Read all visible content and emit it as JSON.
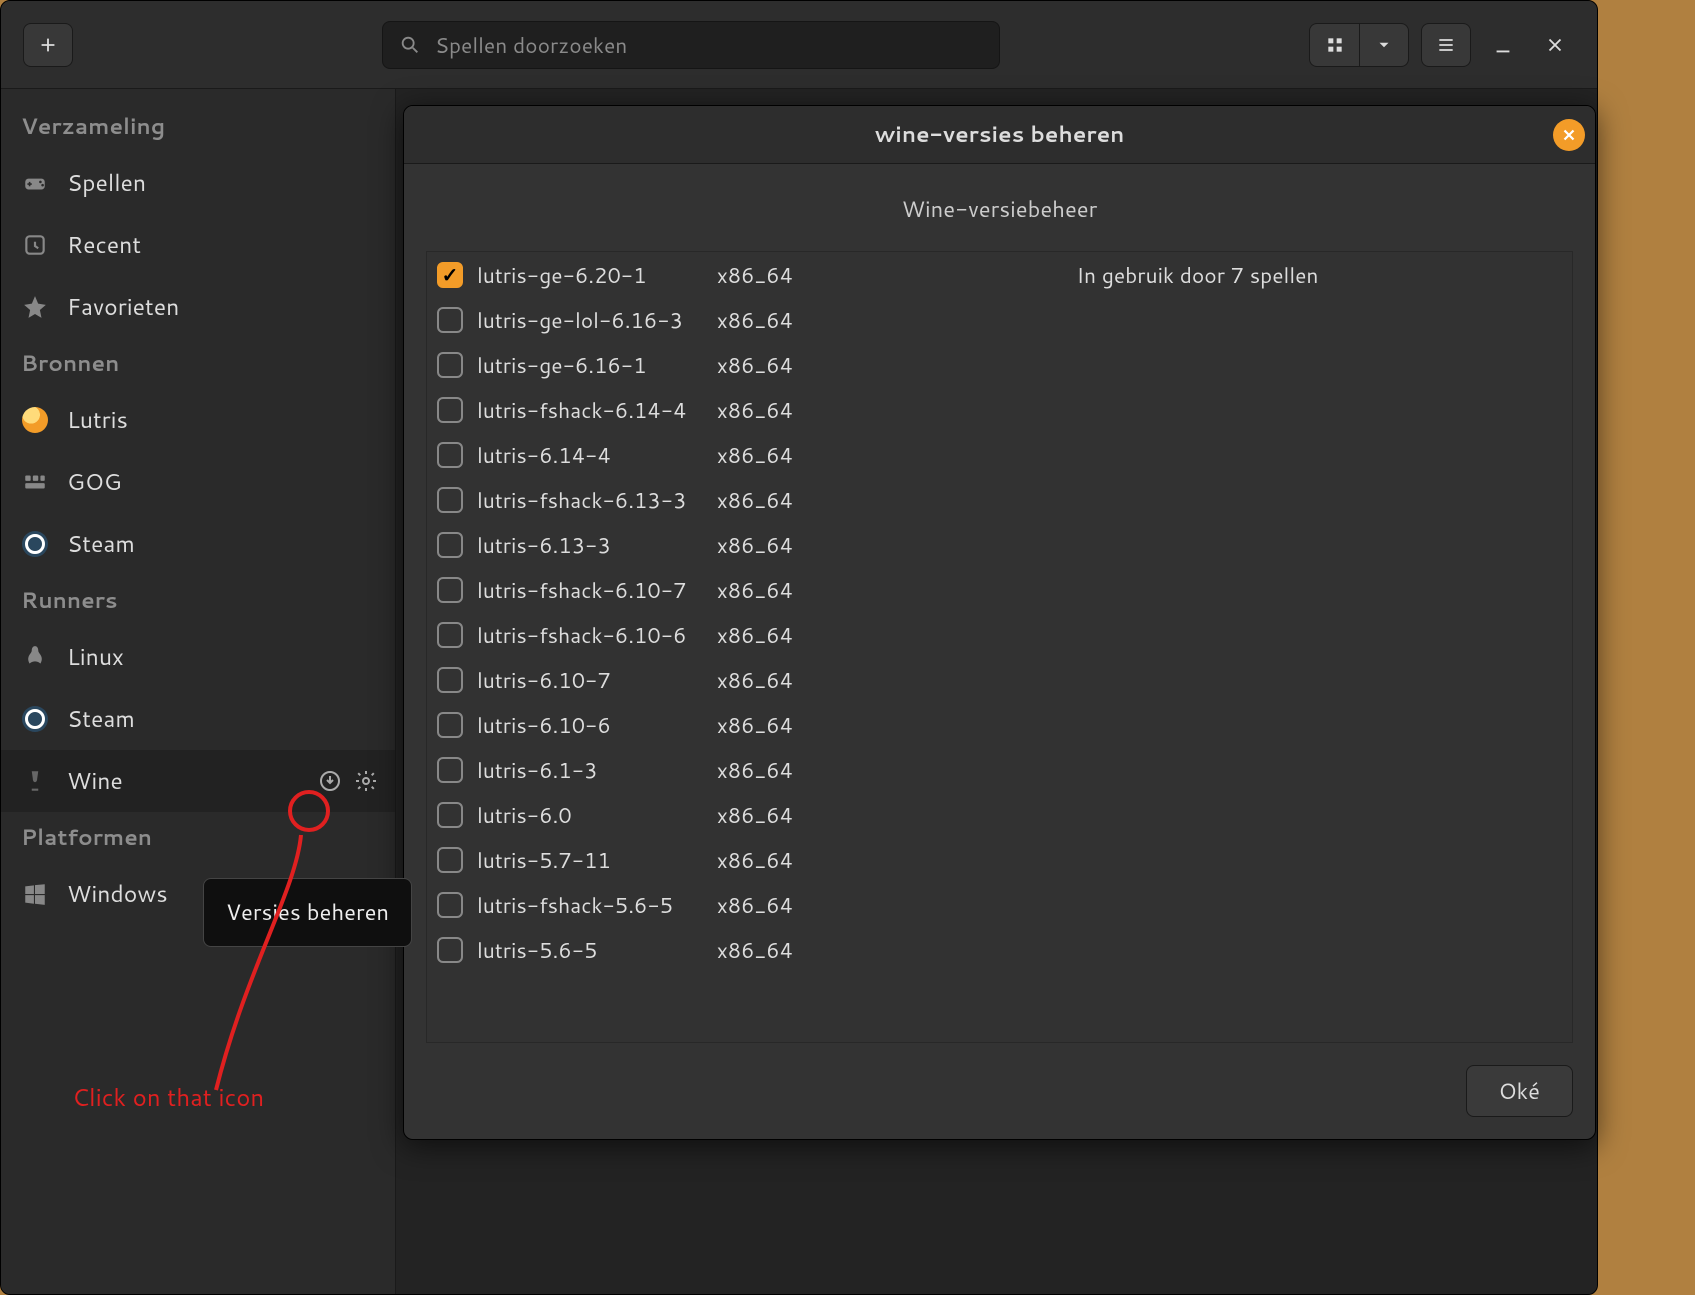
{
  "header": {
    "search_placeholder": "Spellen doorzoeken"
  },
  "sidebar": {
    "section_collection": "Verzameling",
    "items_collection": [
      {
        "icon": "gamepad-icon",
        "label": "Spellen"
      },
      {
        "icon": "clock-icon",
        "label": "Recent"
      },
      {
        "icon": "star-icon",
        "label": "Favorieten"
      }
    ],
    "section_sources": "Bronnen",
    "items_sources": [
      {
        "icon": "lutris-icon",
        "label": "Lutris"
      },
      {
        "icon": "gog-icon",
        "label": "GOG"
      },
      {
        "icon": "steam-icon",
        "label": "Steam"
      }
    ],
    "section_runners": "Runners",
    "items_runners": [
      {
        "icon": "linux-icon",
        "label": "Linux"
      },
      {
        "icon": "steam-icon",
        "label": "Steam"
      },
      {
        "icon": "wine-icon",
        "label": "Wine",
        "active": true,
        "has_actions": true
      }
    ],
    "section_platforms": "Platformen",
    "items_platforms": [
      {
        "icon": "windows-icon",
        "label": "Windows"
      }
    ]
  },
  "tooltip": "Versies beheren",
  "annotation": "Click on that icon",
  "dialog": {
    "title": "wine-versies beheren",
    "subtitle": "Wine-versiebeheer",
    "ok": "Oké",
    "in_use_label": "In gebruik door 7 spellen",
    "rows": [
      {
        "checked": true,
        "name": "lutris-ge-6.20-1",
        "arch": "x86_64",
        "note": true
      },
      {
        "checked": false,
        "name": "lutris-ge-lol-6.16-3",
        "arch": "x86_64"
      },
      {
        "checked": false,
        "name": "lutris-ge-6.16-1",
        "arch": "x86_64"
      },
      {
        "checked": false,
        "name": "lutris-fshack-6.14-4",
        "arch": "x86_64"
      },
      {
        "checked": false,
        "name": "lutris-6.14-4",
        "arch": "x86_64"
      },
      {
        "checked": false,
        "name": "lutris-fshack-6.13-3",
        "arch": "x86_64"
      },
      {
        "checked": false,
        "name": "lutris-6.13-3",
        "arch": "x86_64"
      },
      {
        "checked": false,
        "name": "lutris-fshack-6.10-7",
        "arch": "x86_64"
      },
      {
        "checked": false,
        "name": "lutris-fshack-6.10-6",
        "arch": "x86_64"
      },
      {
        "checked": false,
        "name": "lutris-6.10-7",
        "arch": "x86_64"
      },
      {
        "checked": false,
        "name": "lutris-6.10-6",
        "arch": "x86_64"
      },
      {
        "checked": false,
        "name": "lutris-6.1-3",
        "arch": "x86_64"
      },
      {
        "checked": false,
        "name": "lutris-6.0",
        "arch": "x86_64"
      },
      {
        "checked": false,
        "name": "lutris-5.7-11",
        "arch": "x86_64"
      },
      {
        "checked": false,
        "name": "lutris-fshack-5.6-5",
        "arch": "x86_64"
      },
      {
        "checked": false,
        "name": "lutris-5.6-5",
        "arch": "x86_64"
      }
    ]
  }
}
